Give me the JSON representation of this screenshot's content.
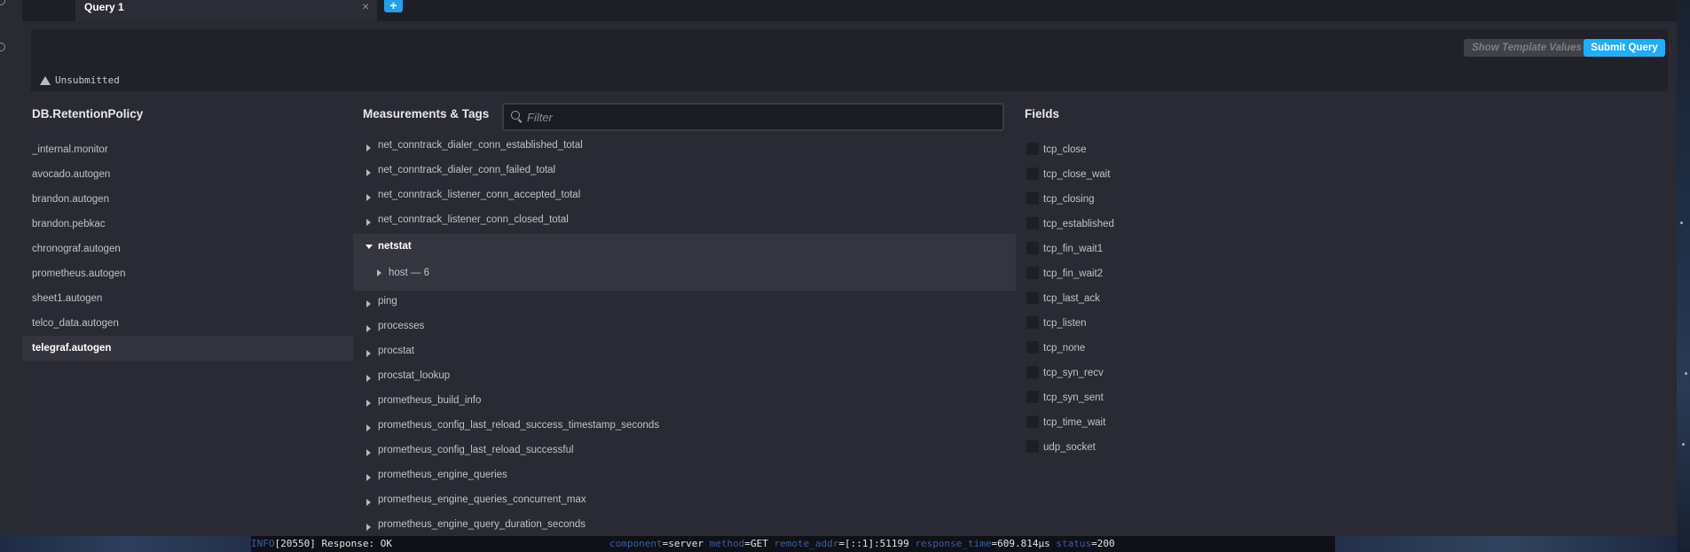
{
  "tab": {
    "title": "Query 1",
    "close_glyph": "×",
    "add_glyph": "+"
  },
  "editor": {
    "status_text": "Unsubmitted",
    "status_icon": "warning-icon",
    "show_template_values_label": "Show Template Values",
    "submit_label": "Submit Query"
  },
  "columns": {
    "db_title": "DB.RetentionPolicy",
    "measurements_title": "Measurements & Tags",
    "fields_title": "Fields",
    "filter_placeholder": "Filter"
  },
  "databases": [
    {
      "label": "_internal.monitor",
      "active": false
    },
    {
      "label": "avocado.autogen",
      "active": false
    },
    {
      "label": "brandon.autogen",
      "active": false
    },
    {
      "label": "brandon.pebkac",
      "active": false
    },
    {
      "label": "chronograf.autogen",
      "active": false
    },
    {
      "label": "prometheus.autogen",
      "active": false
    },
    {
      "label": "sheet1.autogen",
      "active": false
    },
    {
      "label": "telco_data.autogen",
      "active": false
    },
    {
      "label": "telegraf.autogen",
      "active": true
    }
  ],
  "measurements_before": [
    "net_conntrack_dialer_conn_established_total",
    "net_conntrack_dialer_conn_failed_total",
    "net_conntrack_listener_conn_accepted_total",
    "net_conntrack_listener_conn_closed_total"
  ],
  "expanded_measurement": {
    "label": "netstat",
    "tag": "host — 6"
  },
  "measurements_after": [
    "ping",
    "processes",
    "procstat",
    "procstat_lookup",
    "prometheus_build_info",
    "prometheus_config_last_reload_success_timestamp_seconds",
    "prometheus_config_last_reload_successful",
    "prometheus_engine_queries",
    "prometheus_engine_queries_concurrent_max",
    "prometheus_engine_query_duration_seconds"
  ],
  "fields": [
    "tcp_close",
    "tcp_close_wait",
    "tcp_closing",
    "tcp_established",
    "tcp_fin_wait1",
    "tcp_fin_wait2",
    "tcp_last_ack",
    "tcp_listen",
    "tcp_none",
    "tcp_syn_recv",
    "tcp_syn_sent",
    "tcp_time_wait",
    "udp_socket"
  ],
  "log": {
    "level": "INFO",
    "pid_message": "[20550] Response: OK",
    "k_component": "component",
    "v_component": "=server",
    "k_method": "method",
    "v_method": "=GET",
    "k_remote": "remote_addr",
    "v_remote": "=[::1]:51199",
    "k_response": "response_time",
    "v_response": "=609.814µs",
    "k_status": "status",
    "v_status": "=200"
  },
  "colors": {
    "accent": "#22adf6",
    "panel": "#292a33",
    "selected_row": "#33343e"
  }
}
